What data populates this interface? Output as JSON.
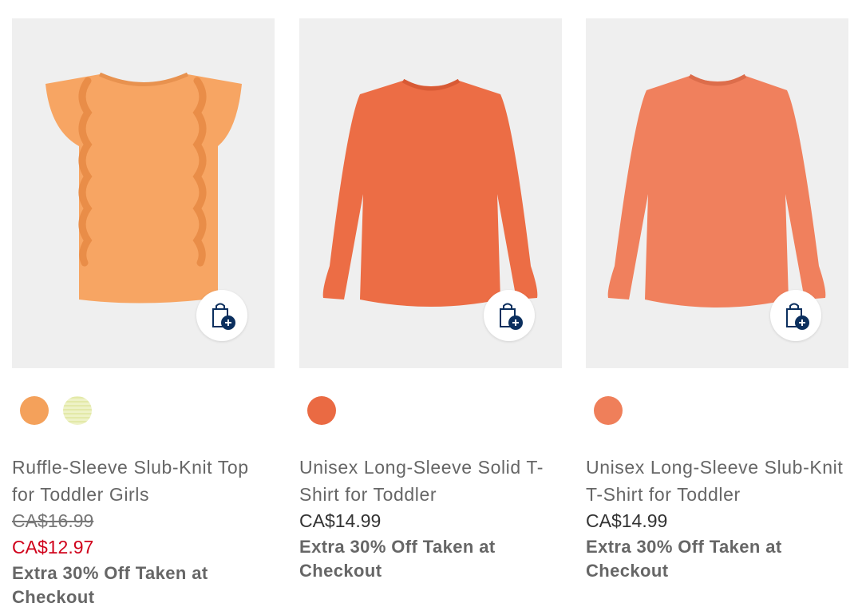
{
  "products": [
    {
      "name": "Ruffle-Sleeve Slub-Knit Top for Toddler Girls",
      "original_price": "CA$16.99",
      "sale_price": "CA$12.97",
      "promo": "Extra 30% Off Taken at Checkout",
      "swatches": [
        "#f4a15b",
        "#eef2c6"
      ],
      "garment_color": "#f7a563",
      "add_to_bag_icon": "shopping-bag-plus-icon"
    },
    {
      "name": "Unisex Long-Sleeve Solid T-Shirt for Toddler",
      "price": "CA$14.99",
      "promo": "Extra 30% Off Taken at Checkout",
      "swatches": [
        "#ea6a43"
      ],
      "garment_color": "#ec6d45",
      "add_to_bag_icon": "shopping-bag-plus-icon"
    },
    {
      "name": "Unisex Long-Sleeve Slub-Knit T-Shirt for Toddler",
      "price": "CA$14.99",
      "promo": "Extra 30% Off Taken at Checkout",
      "swatches": [
        "#ef7f5a"
      ],
      "garment_color": "#f0805d",
      "add_to_bag_icon": "shopping-bag-plus-icon"
    }
  ],
  "colors": {
    "sale_red": "#d0021b",
    "bag_accent": "#0b2f5e",
    "image_bg": "#efefef"
  }
}
